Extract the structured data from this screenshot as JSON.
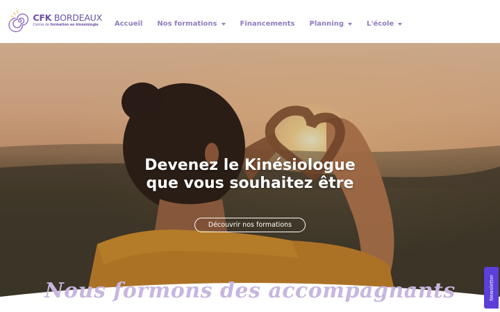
{
  "header": {
    "logo": {
      "title_bold": "CFK",
      "title_rest": " BORDEAUX",
      "subtitle_pre": "Centre de ",
      "subtitle_bold": "formation en kinésiologie"
    },
    "nav": [
      {
        "label": "Accueil",
        "has_dropdown": false
      },
      {
        "label": "Nos formations",
        "has_dropdown": true
      },
      {
        "label": "Financements",
        "has_dropdown": false
      },
      {
        "label": "Planning",
        "has_dropdown": true
      },
      {
        "label": "L'école",
        "has_dropdown": true
      }
    ]
  },
  "hero": {
    "line1_pre": "Devenez ",
    "line1_bold": "le Kinésiologue",
    "line2_pre": "que vous ",
    "line2_bold": "souhaitez être",
    "cta_label": "Découvrir nos formations"
  },
  "section": {
    "heading": "Nous formons des accompagnants"
  },
  "newsletter_tab": {
    "label": "Newsletter"
  },
  "colors": {
    "brand_purple": "#6a4fa3",
    "nav_text": "#8f7cc0",
    "script_heading": "#c7b6df",
    "newsletter_bg": "#5b3fd8"
  }
}
